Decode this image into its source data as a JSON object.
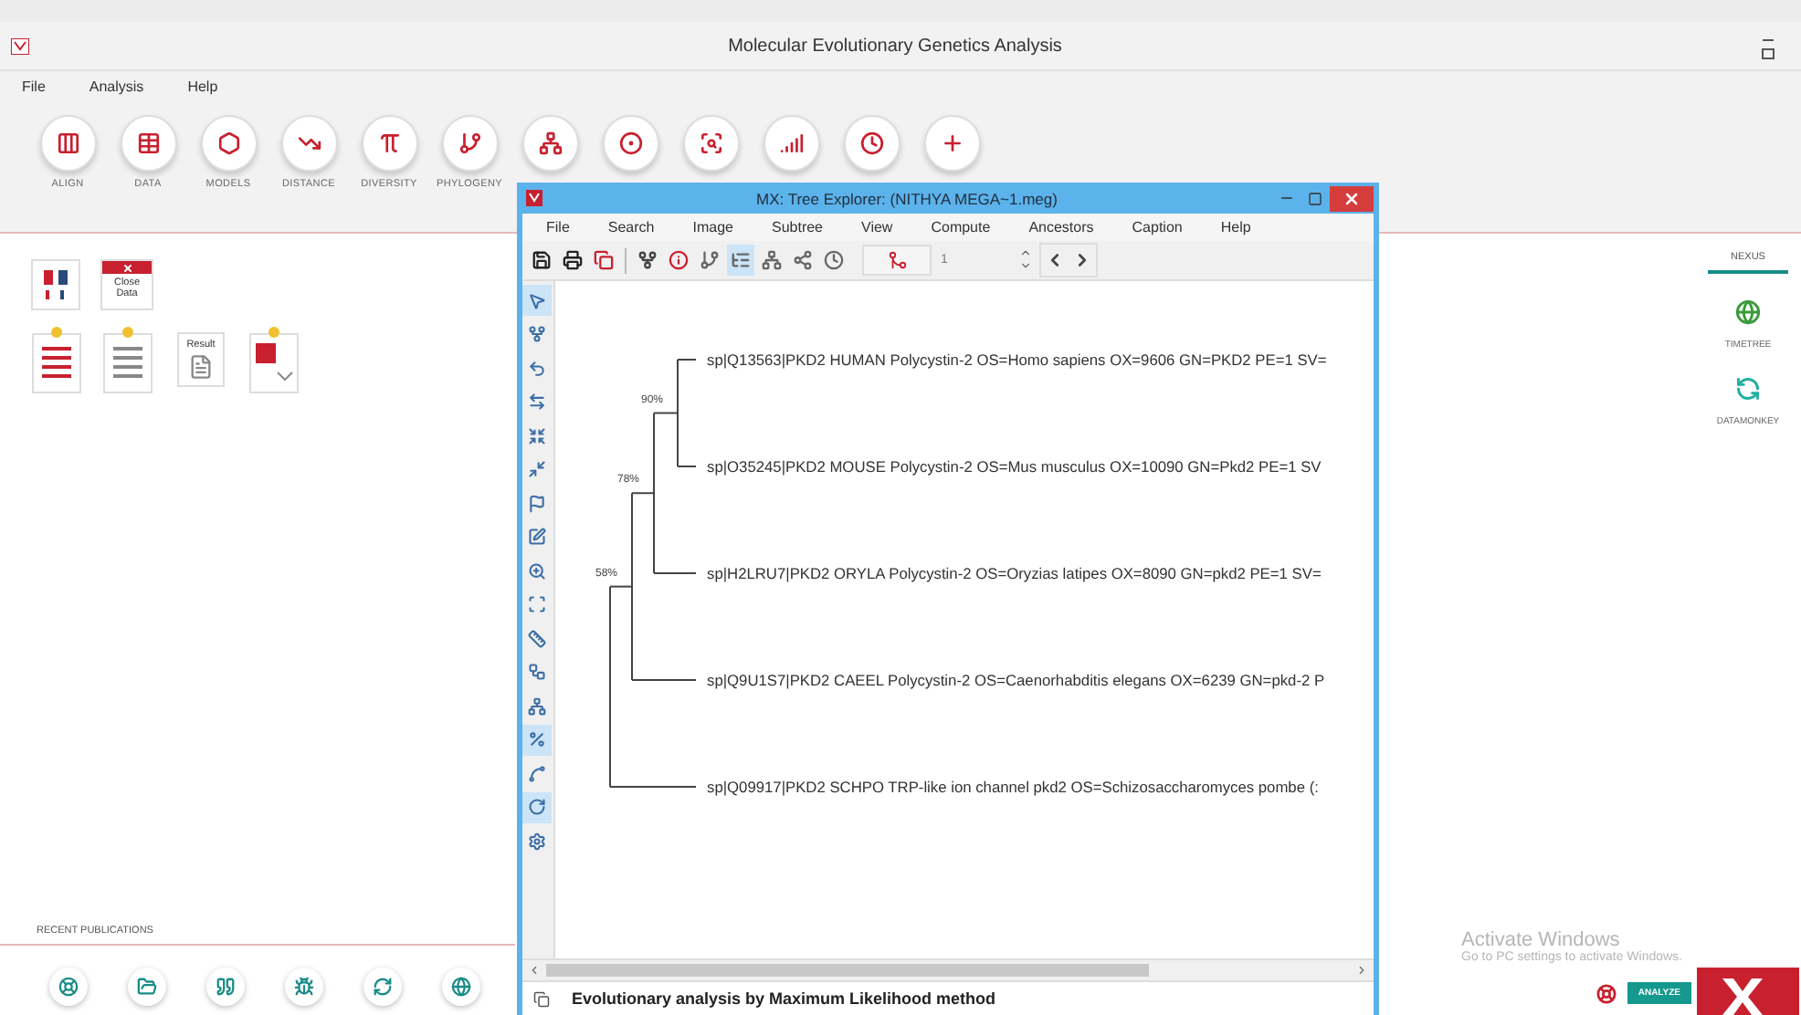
{
  "app": {
    "title": "Molecular Evolutionary Genetics Analysis",
    "menu": [
      "File",
      "Analysis",
      "Help"
    ],
    "toolbar": [
      {
        "kind": "align",
        "label": "ALIGN"
      },
      {
        "kind": "data",
        "label": "DATA"
      },
      {
        "kind": "models",
        "label": "MODELS"
      },
      {
        "kind": "distance",
        "label": "DISTANCE"
      },
      {
        "kind": "diversity",
        "label": "DIVERSITY"
      },
      {
        "kind": "phylogeny",
        "label": "PHYLOGENY"
      },
      {
        "kind": "user-tree"
      },
      {
        "kind": "ancestors"
      },
      {
        "kind": "selection"
      },
      {
        "kind": "rates"
      },
      {
        "kind": "clocks"
      },
      {
        "kind": "diagnose"
      }
    ],
    "close_data": "Close Data",
    "result_label": "Result",
    "recent_publications": "RECENT PUBLICATIONS",
    "footer_links": [
      {
        "kind": "help"
      },
      {
        "kind": "folder"
      },
      {
        "kind": "quote"
      },
      {
        "kind": "bug"
      },
      {
        "kind": "update"
      },
      {
        "kind": "web"
      }
    ],
    "side_tabs": [
      {
        "label": "NEXUS",
        "selected": true
      }
    ],
    "side_links": [
      {
        "kind": "globe",
        "label": "TIMETREE"
      },
      {
        "kind": "monkey",
        "label": "DATAMONKEY"
      }
    ],
    "analyze_button": "ANALYZE"
  },
  "tree_explorer": {
    "title": "MX: Tree Explorer: (NITHYA MEGA~1.meg)",
    "menu": [
      "File",
      "Search",
      "Image",
      "Subtree",
      "View",
      "Compute",
      "Ancestors",
      "Caption",
      "Help"
    ],
    "toolbar": [
      {
        "kind": "save",
        "selected": false
      },
      {
        "kind": "print",
        "selected": false
      },
      {
        "kind": "copy",
        "selected": false
      },
      {
        "kind": "root",
        "selected": false
      },
      {
        "kind": "info",
        "selected": false
      },
      {
        "kind": "rect-tree",
        "selected": false
      },
      {
        "kind": "straight-tree",
        "selected": true
      },
      {
        "kind": "circle-tree",
        "selected": false
      },
      {
        "kind": "radiation",
        "selected": false
      },
      {
        "kind": "clock",
        "selected": false
      }
    ],
    "node_field": "1",
    "tools": [
      {
        "kind": "pointer",
        "selected": true
      },
      {
        "kind": "root",
        "selected": false
      },
      {
        "kind": "flip",
        "selected": false
      },
      {
        "kind": "swap",
        "selected": false
      },
      {
        "kind": "compress",
        "selected": false
      },
      {
        "kind": "collapse",
        "selected": false
      },
      {
        "kind": "mark",
        "selected": false
      },
      {
        "kind": "caption",
        "selected": false
      },
      {
        "kind": "zoom",
        "selected": false
      },
      {
        "kind": "fit",
        "selected": false
      },
      {
        "kind": "ruler",
        "selected": false
      },
      {
        "kind": "topology",
        "selected": false
      },
      {
        "kind": "layout",
        "selected": false
      },
      {
        "kind": "percent",
        "selected": true
      },
      {
        "kind": "branch",
        "selected": false
      },
      {
        "kind": "rotate",
        "selected": true
      },
      {
        "kind": "settings",
        "selected": false
      }
    ],
    "tree": {
      "children": [
        {
          "support": "58%",
          "children": [
            {
              "support": "78%",
              "children": [
                {
                  "support": "90%",
                  "children": [
                    {
                      "label": "sp|Q13563|PKD2 HUMAN Polycystin-2 OS=Homo sapiens OX=9606 GN=PKD2 PE=1 SV="
                    },
                    {
                      "label": "sp|O35245|PKD2 MOUSE Polycystin-2 OS=Mus musculus OX=10090 GN=Pkd2 PE=1 SV"
                    }
                  ]
                },
                {
                  "label": "sp|H2LRU7|PKD2 ORYLA Polycystin-2 OS=Oryzias latipes OX=8090 GN=pkd2 PE=1 SV="
                }
              ]
            },
            {
              "label": "sp|Q9U1S7|PKD2 CAEEL Polycystin-2 OS=Caenorhabditis elegans OX=6239 GN=pkd-2 P"
            }
          ]
        },
        {
          "label": "sp|Q09917|PKD2 SCHPO TRP-like ion channel pkd2 OS=Schizosaccharomyces pombe (:"
        }
      ]
    },
    "caption": "Evolutionary analysis by Maximum Likelihood method"
  },
  "os_notice": {
    "title": "Activate Windows",
    "text": "Go to PC settings to activate Windows."
  }
}
